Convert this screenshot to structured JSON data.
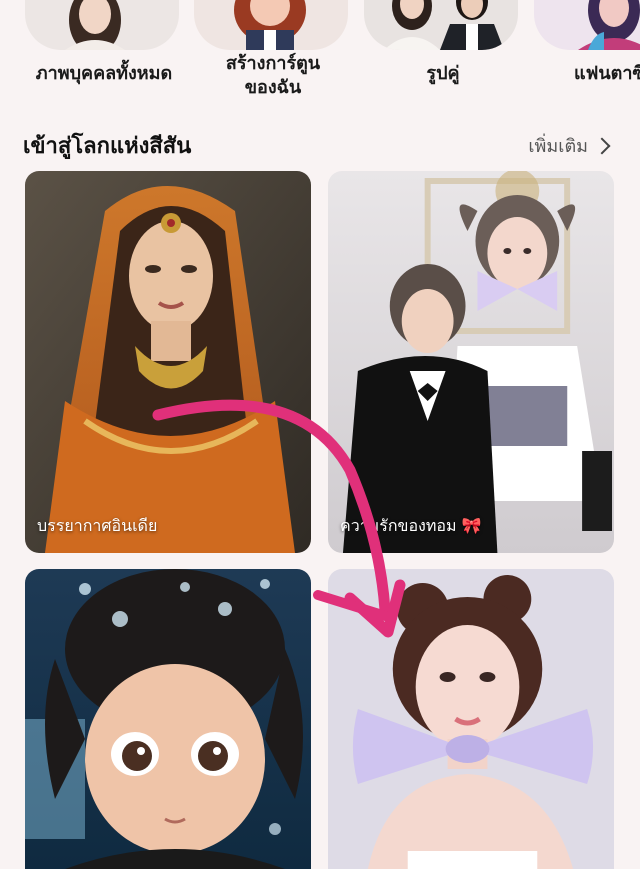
{
  "categories": [
    {
      "label": "ภาพบุคคลทั้งหมด"
    },
    {
      "label": "สร้างการ์ตูน\nของฉัน"
    },
    {
      "label": "รูปคู่"
    },
    {
      "label": "แฟนตาซี"
    }
  ],
  "section": {
    "title": "เข้าสู่โลกแห่งสีสัน",
    "more_label": "เพิ่มเติม"
  },
  "cards": [
    {
      "caption": "บรรยากาศอินเดีย"
    },
    {
      "caption": "ความรักของทอม 🎀"
    },
    {
      "caption": ""
    },
    {
      "caption": ""
    }
  ],
  "colors": {
    "background": "#f9f3f3",
    "annotation_arrow": "#e0307a"
  }
}
